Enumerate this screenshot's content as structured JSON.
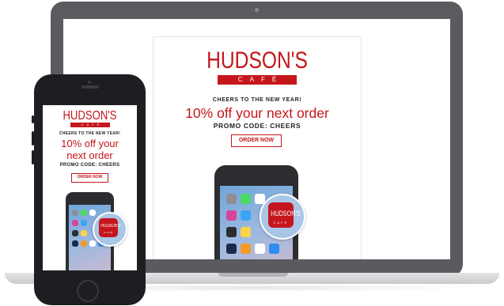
{
  "brand": {
    "name": "HUDSON'S",
    "tagline": "CAFÉ",
    "tile_name": "HUDSON'S",
    "tile_tagline": "CAFÉ"
  },
  "email": {
    "greeting": "CHEERS TO THE NEW YEAR!",
    "offer": "10% off your next order",
    "offer_line1": "10% off your",
    "offer_line2": "next order",
    "promo": "PROMO CODE: CHEERS",
    "cta": "ORDER NOW"
  },
  "colors": {
    "brand_red": "#c4161c",
    "device_dark": "#1d1e21",
    "laptop_gray": "#5a5a5f"
  },
  "icons": [
    "settings-icon",
    "messages-icon",
    "photos-icon",
    "music-icon",
    "maps-icon",
    "notes-icon",
    "news-icon",
    "books-icon",
    "health-icon",
    "appstore-icon"
  ]
}
